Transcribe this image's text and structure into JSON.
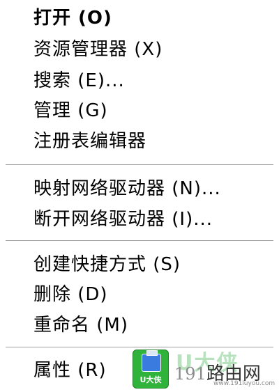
{
  "menu": {
    "items": [
      {
        "label": "打开 (O)",
        "bold": true
      },
      {
        "label": "资源管理器 (X)"
      },
      {
        "label": "搜索 (E)..."
      },
      {
        "label": "管理 (G)"
      },
      {
        "label": "注册表编辑器"
      },
      {
        "label": "映射网络驱动器 (N)..."
      },
      {
        "label": "断开网络驱动器 (I)..."
      },
      {
        "label": "创建快捷方式 (S)"
      },
      {
        "label": "删除 (D)"
      },
      {
        "label": "重命名 (M)"
      },
      {
        "label": "属性 (R)"
      }
    ]
  },
  "watermark": {
    "logo_text": "U大侠",
    "brand_text": "U大侠",
    "site_number": "191",
    "site_text": "路由网",
    "site_url": "www.191luyou.com",
    "logo_color": "#2fb33a"
  }
}
